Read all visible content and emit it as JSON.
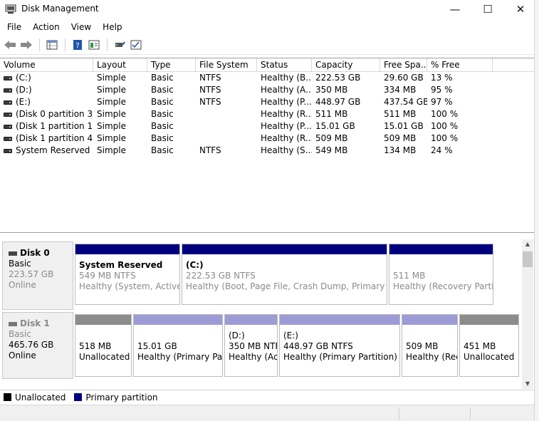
{
  "window": {
    "title": "Disk Management",
    "minimize_glyph": "—",
    "maximize_glyph": "☐",
    "close_glyph": "✕"
  },
  "menu": [
    "File",
    "Action",
    "View",
    "Help"
  ],
  "toolbar": {
    "icons": [
      "back-icon",
      "forward-icon",
      "disk-list-icon",
      "help-icon",
      "properties-icon",
      "connect-icon",
      "check-icon"
    ]
  },
  "volume_list": {
    "columns": [
      "Volume",
      "Layout",
      "Type",
      "File System",
      "Status",
      "Capacity",
      "Free Spa...",
      "% Free"
    ],
    "rows": [
      {
        "volume": "(C:)",
        "layout": "Simple",
        "type": "Basic",
        "fs": "NTFS",
        "status": "Healthy (B...",
        "capacity": "222.53 GB",
        "free": "29.60 GB",
        "pct": "13 %"
      },
      {
        "volume": "(D:)",
        "layout": "Simple",
        "type": "Basic",
        "fs": "NTFS",
        "status": "Healthy (A...",
        "capacity": "350 MB",
        "free": "334 MB",
        "pct": "95 %"
      },
      {
        "volume": "(E:)",
        "layout": "Simple",
        "type": "Basic",
        "fs": "NTFS",
        "status": "Healthy (P...",
        "capacity": "448.97 GB",
        "free": "437.54 GB",
        "pct": "97 %"
      },
      {
        "volume": "(Disk 0 partition 3)",
        "layout": "Simple",
        "type": "Basic",
        "fs": "",
        "status": "Healthy (R...",
        "capacity": "511 MB",
        "free": "511 MB",
        "pct": "100 %"
      },
      {
        "volume": "(Disk 1 partition 1)",
        "layout": "Simple",
        "type": "Basic",
        "fs": "",
        "status": "Healthy (P...",
        "capacity": "15.01 GB",
        "free": "15.01 GB",
        "pct": "100 %"
      },
      {
        "volume": "(Disk 1 partition 4)",
        "layout": "Simple",
        "type": "Basic",
        "fs": "",
        "status": "Healthy (R...",
        "capacity": "509 MB",
        "free": "509 MB",
        "pct": "100 %"
      },
      {
        "volume": "System Reserved",
        "layout": "Simple",
        "type": "Basic",
        "fs": "NTFS",
        "status": "Healthy (S...",
        "capacity": "549 MB",
        "free": "134 MB",
        "pct": "24 %"
      }
    ]
  },
  "disks": [
    {
      "name": "Disk 0",
      "type": "Basic",
      "size": "223.57 GB",
      "state": "Online",
      "partitions": [
        {
          "name": "System Reserved",
          "detail": "549 MB NTFS",
          "status": "Healthy (System, Active, P"
        },
        {
          "name": "(C:)",
          "detail": "222.53 GB NTFS",
          "status": "Healthy (Boot, Page File, Crash Dump, Primary Partit"
        },
        {
          "name": "",
          "detail": "511 MB",
          "status": "Healthy (Recovery Partitio"
        }
      ]
    },
    {
      "name": "Disk 1",
      "type": "Basic",
      "size": "465.76 GB",
      "state": "Online",
      "partitions": [
        {
          "name": "",
          "detail": "518 MB",
          "status": "Unallocated"
        },
        {
          "name": "",
          "detail": "15.01 GB",
          "status": "Healthy (Primary Part"
        },
        {
          "name": "(D:)",
          "detail": "350 MB NTFS",
          "status": "Healthy (Ac"
        },
        {
          "name": "(E:)",
          "detail": "448.97 GB NTFS",
          "status": "Healthy (Primary Partition)"
        },
        {
          "name": "",
          "detail": "509 MB",
          "status": "Healthy (Rec"
        },
        {
          "name": "",
          "detail": "451 MB",
          "status": "Unallocated"
        }
      ]
    }
  ],
  "legend": [
    {
      "label": "Unallocated",
      "color": "#000000"
    },
    {
      "label": "Primary partition",
      "color": "#00007f"
    }
  ],
  "colors": {
    "primary_bar": "#00007f",
    "unallocated_bar": "#8c8c8c",
    "secondary_disk_bar": "#9d9bd5"
  }
}
